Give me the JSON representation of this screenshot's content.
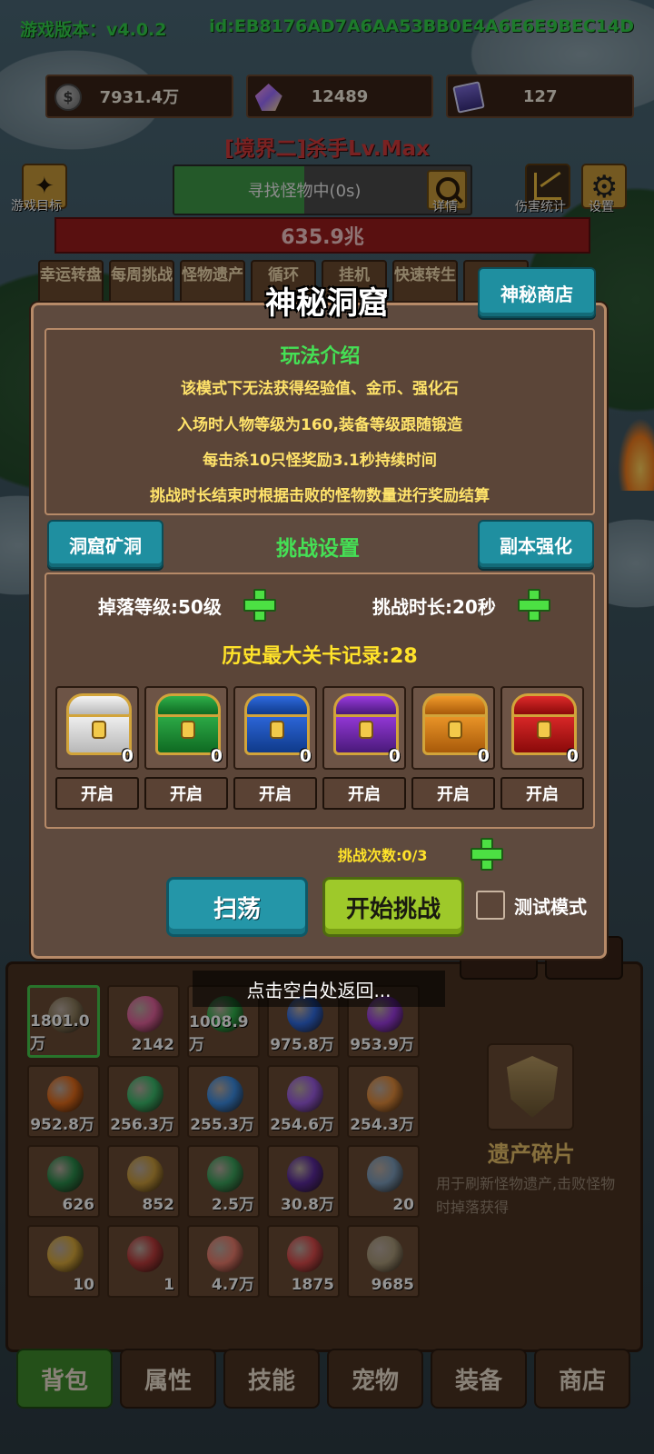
{
  "colors": {
    "accent_green": "#45e055",
    "accent_yellow": "#ffe32a",
    "teal_button": "#1f8fa0",
    "modal_bg": "#5e4a3e",
    "hp_red": "#9a1c1c"
  },
  "header": {
    "version_label": "游戏版本：v4.0.2",
    "player_id": "id:EB8176AD7A6AA53BB0E4A6E6E9BEC14D"
  },
  "resources": [
    {
      "icon": "silver-coin-icon",
      "value": "7931.4万"
    },
    {
      "icon": "crystal-icon",
      "value": "12489"
    },
    {
      "icon": "card-icon",
      "value": "127"
    }
  ],
  "player_title": "[境界二]杀手Lv.Max",
  "search": {
    "status": "寻找怪物中(0s)",
    "progress": 0.44,
    "detail_label": "详情"
  },
  "side_buttons": {
    "game_goal": "游戏目标",
    "damage_stats": "伤害统计",
    "settings": "设置"
  },
  "hp_value": "635.9兆",
  "mode_tabs": [
    "幸运转盘",
    "每周挑战",
    "怪物遗产",
    "循环",
    "挂机",
    "快速转生",
    ""
  ],
  "modal": {
    "title": "神秘洞窟",
    "shop_button": "神秘商店",
    "intro_title": "玩法介绍",
    "intro_lines": [
      "该模式下无法获得经验值、金币、强化石",
      "入场时人物等级为160,装备等级跟随锻造",
      "每击杀10只怪奖励3.1秒持续时间",
      "挑战时长结束时根据击败的怪物数量进行奖励结算"
    ],
    "mine_button": "洞窟矿洞",
    "settings_title": "挑战设置",
    "enhance_button": "副本强化",
    "drop_level": "掉落等级:50级",
    "challenge_duration": "挑战时长:20秒",
    "record": "历史最大关卡记录:28",
    "chests": [
      {
        "color": "white",
        "count": "0",
        "open_label": "开启"
      },
      {
        "color": "green",
        "count": "0",
        "open_label": "开启"
      },
      {
        "color": "blue",
        "count": "0",
        "open_label": "开启"
      },
      {
        "color": "purple",
        "count": "0",
        "open_label": "开启"
      },
      {
        "color": "orange",
        "count": "0",
        "open_label": "开启"
      },
      {
        "color": "red",
        "count": "0",
        "open_label": "开启"
      }
    ],
    "attempts": "挑战次数:0/3",
    "sweep_button": "扫荡",
    "start_button": "开始挑战",
    "test_mode_label": "测试模式"
  },
  "back_hint": "点击空白处返回...",
  "bag": {
    "items": [
      {
        "icon": "legacy-shard-icon",
        "count": "1801.0万",
        "color": "#8a7a5a"
      },
      {
        "icon": "pink-gem-icon",
        "count": "2142",
        "color": "#e0609a"
      },
      {
        "icon": "green-orb-icon",
        "count": "1008.9万",
        "color": "#2fae4a"
      },
      {
        "icon": "blue-orb-icon",
        "count": "975.8万",
        "color": "#2f6adf"
      },
      {
        "icon": "purple-orb-icon",
        "count": "953.9万",
        "color": "#9a3adf"
      },
      {
        "icon": "orange-orb-icon",
        "count": "952.8万",
        "color": "#e06a1a"
      },
      {
        "icon": "green-swirl-icon",
        "count": "256.3万",
        "color": "#3ab86a"
      },
      {
        "icon": "blue-swirl-icon",
        "count": "255.3万",
        "color": "#3a8ae0"
      },
      {
        "icon": "purple-swirl-icon",
        "count": "254.6万",
        "color": "#9a5ae0"
      },
      {
        "icon": "orange-swirl-icon",
        "count": "254.3万",
        "color": "#e08a3a"
      },
      {
        "icon": "green-rune-icon",
        "count": "626",
        "color": "#2a8a4a"
      },
      {
        "icon": "treasure-chest-icon",
        "count": "852",
        "color": "#c89a3a"
      },
      {
        "icon": "green-pearls-icon",
        "count": "2.5万",
        "color": "#3aa05a"
      },
      {
        "icon": "grape-icon",
        "count": "30.8万",
        "color": "#5a2a9a"
      },
      {
        "icon": "map-scroll-icon",
        "count": "20",
        "color": "#7a9ab8"
      },
      {
        "icon": "golden-hand-icon",
        "count": "10",
        "color": "#d8a83a"
      },
      {
        "icon": "amulet-icon",
        "count": "1",
        "color": "#b83a3a"
      },
      {
        "icon": "peach-icon",
        "count": "4.7万",
        "color": "#e87a6a"
      },
      {
        "icon": "gift-box-icon",
        "count": "1875",
        "color": "#d84a4a"
      },
      {
        "icon": "scroll-icon",
        "count": "9685",
        "color": "#a89878"
      }
    ],
    "detail": {
      "name": "遗产碎片",
      "description": "用于刷新怪物遗产,击败怪物时掉落获得"
    }
  },
  "bottom_nav": [
    "背包",
    "属性",
    "技能",
    "宠物",
    "装备",
    "商店"
  ]
}
